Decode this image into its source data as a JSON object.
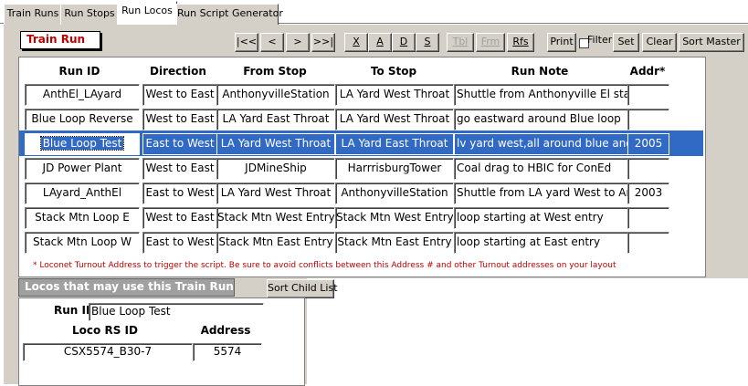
{
  "tabs": [
    "Train Runs",
    "Run Stops",
    "Run Locos",
    "Run Script Generator"
  ],
  "active_tab": "Run Locos",
  "section_title": "Train Run",
  "nav_buttons": [
    "|<<",
    "<",
    ">",
    ">>|",
    "X",
    "A",
    "D",
    "S",
    "Tbl",
    "Frm",
    "Rfs"
  ],
  "toolbar": {
    "print": "Print",
    "filter": "Filter",
    "set": "Set",
    "clear": "Clear",
    "sort_master": "Sort Master"
  },
  "grid": {
    "headers": [
      "Run ID",
      "Direction",
      "From Stop",
      "To Stop",
      "Run Note",
      "Addr*"
    ],
    "rows": [
      {
        "run_id": "AnthEl_LAyard",
        "direction": "West to East",
        "from": "AnthonyvilleStation",
        "to": "LA Yard West Throat",
        "note": "Shuttle from Anthonyville El stat",
        "addr": ""
      },
      {
        "run_id": "Blue Loop Reverse",
        "direction": "West to East",
        "from": "LA Yard East Throat",
        "to": "LA Yard West Throat",
        "note": "go eastward around Blue loop",
        "addr": ""
      },
      {
        "run_id": "Blue Loop Test",
        "direction": "East to West",
        "from": "LA Yard West Throat",
        "to": "LA Yard East Throat",
        "note": "lv yard west,all around blue and",
        "addr": "2005"
      },
      {
        "run_id": "JD Power Plant",
        "direction": "West to East",
        "from": "JDMineShip",
        "to": "HarrrisburgTower",
        "note": "Coal drag to HBIC for ConEd",
        "addr": ""
      },
      {
        "run_id": "LAyard_AnthEl",
        "direction": "East to West",
        "from": "LA Yard West Throat",
        "to": "AnthonyvilleStation",
        "note": "Shuttle from LA yard West to Ar",
        "addr": "2003"
      },
      {
        "run_id": "Stack Mtn Loop E",
        "direction": "West to East",
        "from": "Stack Mtn West Entry",
        "to": "Stack Mtn West Entry",
        "note": "loop starting at West entry",
        "addr": ""
      },
      {
        "run_id": "Stack Mtn Loop W",
        "direction": "East to West",
        "from": "Stack Mtn East Entry",
        "to": "Stack Mtn East Entry",
        "note": "loop starting at East entry",
        "addr": ""
      }
    ],
    "selected_row": 2
  },
  "footnote": "* Loconet Turnout Address to trigger the script. Be sure to avoid conflicts between this Address # and other Turnout addresses on your layout",
  "locos": {
    "title": "Locos that may use this Train Run",
    "sort_child_label": "Sort Child List",
    "run_id_label": "Run ID",
    "run_id_value": "Blue Loop Test",
    "col_loco": "Loco RS ID",
    "col_address": "Address",
    "rows": [
      {
        "loco": "CSX5574_B30-7",
        "address": "5574"
      }
    ]
  }
}
